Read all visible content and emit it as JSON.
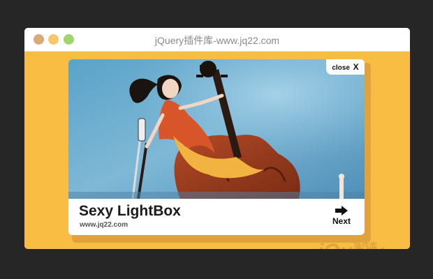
{
  "window": {
    "title": "jQuery插件库-www.jq22.com",
    "controls": [
      "close-dot",
      "minimize-dot",
      "maximize-dot"
    ],
    "colors": {
      "background": "#f9bd44",
      "titlebar": "#ffffff"
    }
  },
  "lightbox": {
    "close_label": "close",
    "close_glyph": "X",
    "title": "Sexy LightBox",
    "subtitle": "www.jq22.com",
    "next_label": "Next",
    "image_description_icon": "cellist-illustration"
  },
  "watermark": {
    "brand": "jQuery",
    "tag": "插件库"
  }
}
